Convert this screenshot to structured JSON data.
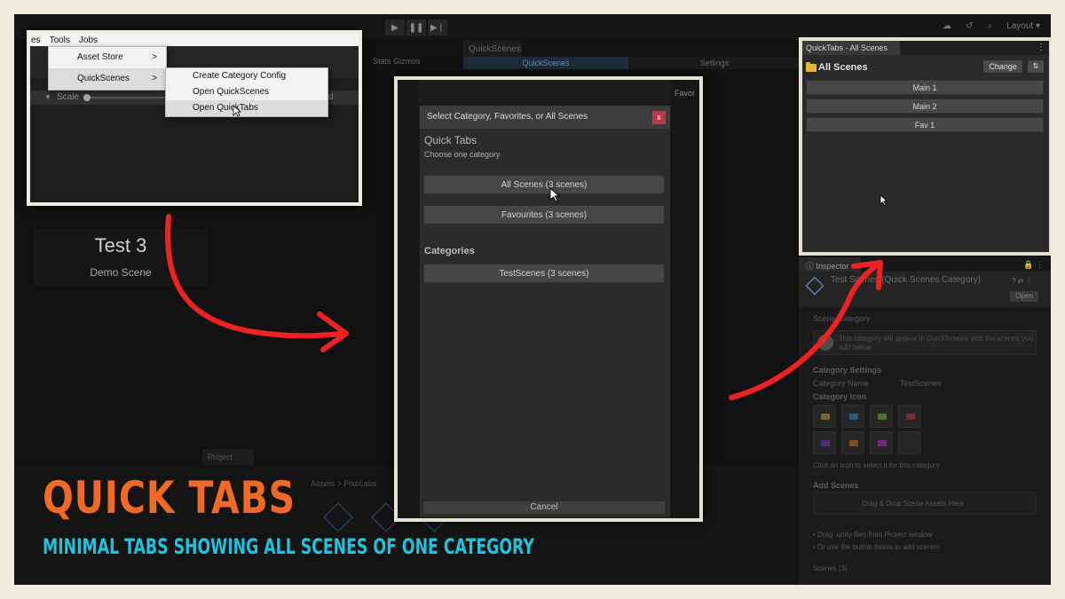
{
  "background_editor": {
    "quickscenes_tab": "QuickScenes",
    "qs_bar_left": "QuickScenes",
    "qs_bar_right": "Settings",
    "stats_label": "Stats",
    "gizmos_label": "Gizmos",
    "layout_label": "Layout",
    "scene_card_title": "Test 3",
    "scene_card_subtitle": "Demo Scene",
    "project_tab": "Project",
    "assets_breadcrumb": "Assets > PixeLabs"
  },
  "menu_panel": {
    "menubar": [
      "es",
      "Tools",
      "Jobs"
    ],
    "main_menu": [
      {
        "label": "Asset Store",
        "arrow": ">"
      },
      {
        "label": "QuickScenes",
        "arrow": ">"
      }
    ],
    "sub_menu": [
      {
        "label": "Create Category Config"
      },
      {
        "label": "Open QuickScenes"
      },
      {
        "label": "Open QuickTabs"
      }
    ],
    "scale_label": "Scale",
    "paused_label": "ased"
  },
  "dialog": {
    "title": "Select Category, Favorites, or All Scenes",
    "close": "x",
    "heading": "Quick Tabs",
    "subheading": "Choose one category",
    "buttons": [
      {
        "label": "All Scenes (3 scenes)"
      },
      {
        "label": "Favourites (3 scenes)"
      }
    ],
    "categories_label": "Categories",
    "category_buttons": [
      {
        "label": "TestScenes (3 scenes)"
      }
    ],
    "cancel": "Cancel",
    "side_text": "Favor"
  },
  "quick_tabs": {
    "tab_title": "QuickTabs - All Scenes",
    "header_title": "All Scenes",
    "change_button": "Change",
    "sort_button": "⇅",
    "scenes": [
      "Main 1",
      "Main 2",
      "Fav 1"
    ]
  },
  "inspector": {
    "tab": "Inspector",
    "title": "Test Scenes (Quick Scenes Category)",
    "open_button": "Open",
    "section_scene_category": "Scene Category",
    "info_text": "This category will appear in QuickScenes with the scenes you add below.",
    "category_settings": "Category Settings",
    "category_name_label": "Category Name",
    "category_name_value": "TestScenes",
    "category_icon": "Category Icon",
    "icon_hint": "Click an icon to select it for this category",
    "add_scenes": "Add Scenes",
    "drop_hint": "Drag & Drop Scene Assets Here",
    "bullet1": "• Drag .unity files from Project window",
    "bullet2": "• Or use the button below to add scenes",
    "footer": "Scenes (3)",
    "icon_colors": [
      "#e5b23b",
      "#3b9bd6",
      "#7fd33a",
      "#d43a3a",
      "#8a3ad4",
      "#e5862b",
      "#c43ad4",
      "#2a2a2a"
    ]
  },
  "overlay": {
    "title": "QUICK TABS",
    "subtitle": "MINIMAL TABS SHOWING ALL SCENES OF ONE CATEGORY",
    "title_color": "#f06a25",
    "subtitle_color": "#1fc3de",
    "arrow_color": "#ee2222"
  }
}
